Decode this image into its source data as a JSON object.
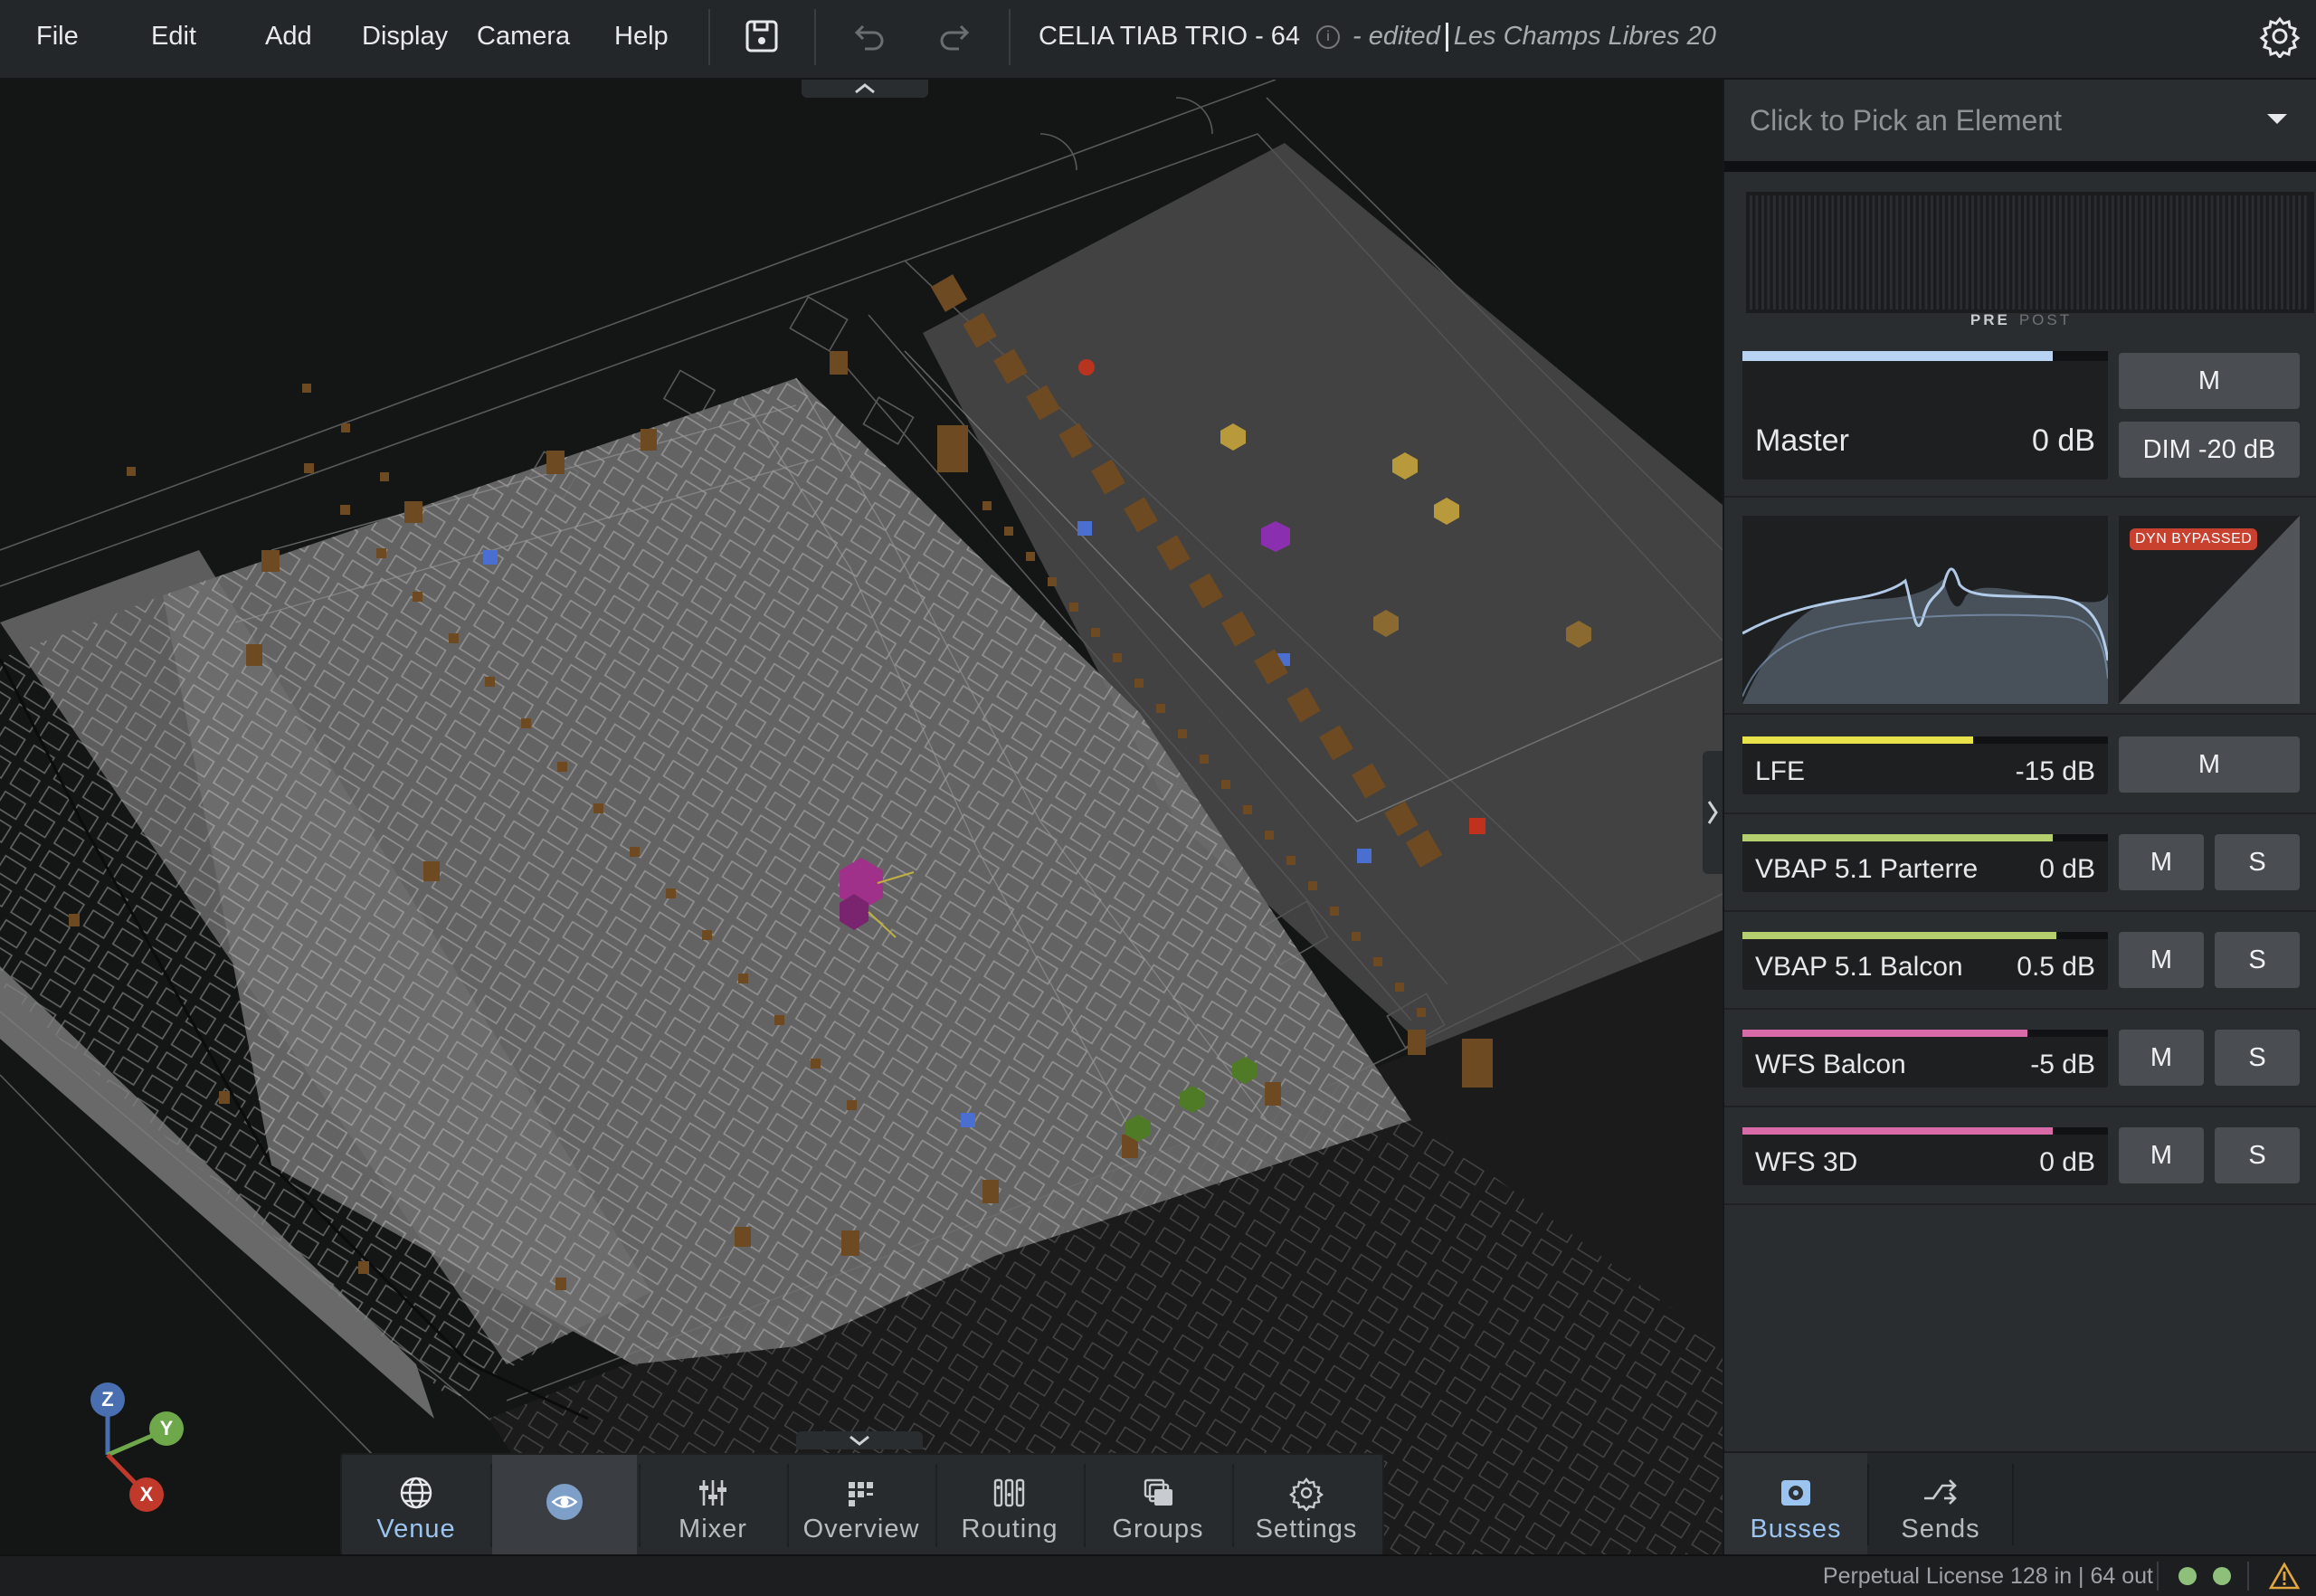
{
  "menu": {
    "file": "File",
    "edit": "Edit",
    "add": "Add",
    "display": "Display",
    "camera": "Camera",
    "help": "Help"
  },
  "toolbar": {
    "save_icon": "save-icon",
    "undo_icon": "undo-icon",
    "redo_icon": "redo-icon",
    "settings_icon": "gear-icon"
  },
  "title": {
    "project": "CELIA TIAB TRIO - 64",
    "edited": "- edited",
    "venue": "Les Champs Libres 20"
  },
  "viewport": {
    "axes": {
      "x": "X",
      "y": "Y",
      "z": "Z"
    },
    "colors": {
      "x": "#c0392b",
      "y": "#6fa84a",
      "z": "#4a6fb0"
    }
  },
  "bottom_nav": [
    {
      "label": "Venue",
      "icon": "globe-icon",
      "active": true
    },
    {
      "label": "",
      "icon": "eye-icon",
      "active": false
    },
    {
      "label": "Mixer",
      "icon": "sliders-icon",
      "active": false
    },
    {
      "label": "Overview",
      "icon": "grid-icon",
      "active": false
    },
    {
      "label": "Routing",
      "icon": "routing-icon",
      "active": false
    },
    {
      "label": "Groups",
      "icon": "layers-icon",
      "active": false
    },
    {
      "label": "Settings",
      "icon": "gear-icon",
      "active": false
    }
  ],
  "panel": {
    "picker": {
      "text": "Click to Pick an Element"
    },
    "meter": {
      "pre": "PRE",
      "post": "POST"
    },
    "master": {
      "name": "Master",
      "value": "0 dB",
      "level": 0.85,
      "color": "#b9d3f2",
      "mute": "M",
      "dim": "DIM -20 dB"
    },
    "eq": {
      "color": "#b9d3f2"
    },
    "dyn": {
      "badge": "DYN BYPASSED"
    },
    "busses": [
      {
        "name": "LFE",
        "value": "-15 dB",
        "level": 0.63,
        "color": "#e8e24a",
        "mute": "M",
        "solo": ""
      },
      {
        "name": "VBAP 5.1 Parterre",
        "value": "0 dB",
        "level": 0.85,
        "color": "#b6cf6e",
        "mute": "M",
        "solo": "S"
      },
      {
        "name": "VBAP 5.1 Balcon",
        "value": "0.5 dB",
        "level": 0.86,
        "color": "#b6cf6e",
        "mute": "M",
        "solo": "S"
      },
      {
        "name": "WFS Balcon",
        "value": "-5 dB",
        "level": 0.78,
        "color": "#d86aa8",
        "mute": "M",
        "solo": "S"
      },
      {
        "name": "WFS 3D",
        "value": "0 dB",
        "level": 0.85,
        "color": "#d86aa8",
        "mute": "M",
        "solo": "S"
      }
    ],
    "tabs": [
      {
        "label": "Busses",
        "icon": "speaker-icon",
        "active": true
      },
      {
        "label": "Sends",
        "icon": "sends-icon",
        "active": false
      }
    ]
  },
  "status": {
    "license": "Perpetual License 128 in | 64 out",
    "warning_icon": "warning-icon"
  }
}
